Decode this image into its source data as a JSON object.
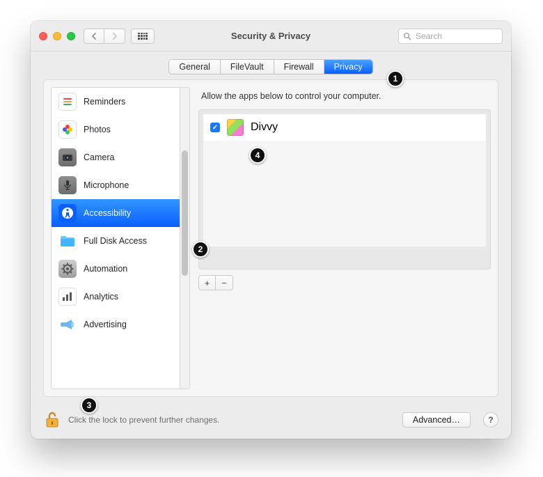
{
  "window": {
    "title": "Security & Privacy"
  },
  "search": {
    "placeholder": "Search"
  },
  "tabs": [
    {
      "label": "General"
    },
    {
      "label": "FileVault"
    },
    {
      "label": "Firewall"
    },
    {
      "label": "Privacy",
      "selected": true
    }
  ],
  "sidebar": {
    "items": [
      {
        "label": "Reminders",
        "icon": "reminders-icon"
      },
      {
        "label": "Photos",
        "icon": "photos-icon"
      },
      {
        "label": "Camera",
        "icon": "camera-icon"
      },
      {
        "label": "Microphone",
        "icon": "microphone-icon"
      },
      {
        "label": "Accessibility",
        "icon": "accessibility-icon",
        "selected": true
      },
      {
        "label": "Full Disk Access",
        "icon": "folder-icon"
      },
      {
        "label": "Automation",
        "icon": "automation-icon"
      },
      {
        "label": "Analytics",
        "icon": "analytics-icon"
      },
      {
        "label": "Advertising",
        "icon": "advertising-icon"
      }
    ]
  },
  "main": {
    "description": "Allow the apps below to control your computer.",
    "apps": [
      {
        "name": "Divvy",
        "checked": true
      }
    ]
  },
  "footer": {
    "lock_text": "Click the lock to prevent further changes.",
    "advanced_label": "Advanced…",
    "help_label": "?"
  },
  "annotations": [
    "1",
    "2",
    "3",
    "4"
  ]
}
